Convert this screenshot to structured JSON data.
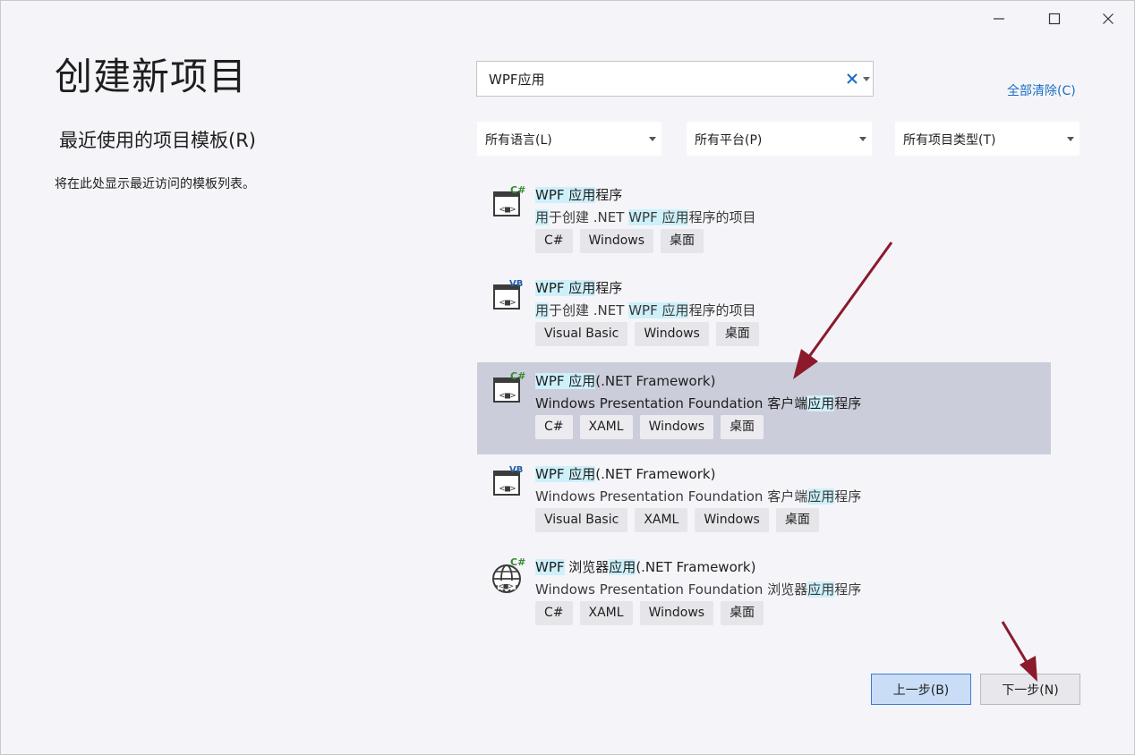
{
  "window_controls": {
    "minimize_icon": "minimize-icon",
    "maximize_icon": "maximize-icon",
    "close_icon": "close-icon"
  },
  "page_title": "创建新项目",
  "recent": {
    "title": "最近使用的项目模板(R)",
    "empty_text": "将在此处显示最近访问的模板列表。"
  },
  "search": {
    "value": "WPF应用"
  },
  "clear_all_label": "全部清除(C)",
  "filters": {
    "language": "所有语言(L)",
    "platform": "所有平台(P)",
    "project_type": "所有项目类型(T)"
  },
  "templates": [
    {
      "icon": "wpf-app-csharp-icon",
      "name_hl": "WPF 应用",
      "name_rest": "程序",
      "desc_pre": "",
      "desc_hl1": "用",
      "desc_mid1": "于创建 .NET ",
      "desc_hl2": "WPF 应用",
      "desc_post": "程序的项目",
      "tags": [
        "C#",
        "Windows",
        "桌面"
      ]
    },
    {
      "icon": "wpf-app-vb-icon",
      "name_hl": "WPF 应用",
      "name_rest": "程序",
      "desc_pre": "",
      "desc_hl1": "用",
      "desc_mid1": "于创建 .NET ",
      "desc_hl2": "WPF 应用",
      "desc_post": "程序的项目",
      "tags": [
        "Visual Basic",
        "Windows",
        "桌面"
      ]
    },
    {
      "icon": "wpf-framework-csharp-icon",
      "name_hl": "WPF 应用",
      "name_rest": "(.NET Framework)",
      "desc_pre": "Windows Presentation Foundation 客户端",
      "desc_hl1": "应用",
      "desc_mid1": "程序",
      "desc_hl2": "",
      "desc_post": "",
      "tags": [
        "C#",
        "XAML",
        "Windows",
        "桌面"
      ]
    },
    {
      "icon": "wpf-framework-vb-icon",
      "name_hl": "WPF 应用",
      "name_rest": "(.NET Framework)",
      "desc_pre": "Windows Presentation Foundation 客户端",
      "desc_hl1": "应用",
      "desc_mid1": "程序",
      "desc_hl2": "",
      "desc_post": "",
      "tags": [
        "Visual Basic",
        "XAML",
        "Windows",
        "桌面"
      ]
    },
    {
      "icon": "wpf-browser-csharp-icon",
      "name_hl": "WPF",
      "name_rest": " 浏览器",
      "name_hl2": "应用",
      "name_rest2": "(.NET Framework)",
      "desc_pre": "Windows Presentation Foundation 浏览器",
      "desc_hl1": "应用",
      "desc_mid1": "程序",
      "desc_hl2": "",
      "desc_post": "",
      "tags": [
        "C#",
        "XAML",
        "Windows",
        "桌面"
      ]
    }
  ],
  "selected_template_index": 2,
  "buttons": {
    "back": "上一步(B)",
    "next": "下一步(N)"
  },
  "colors": {
    "background": "#f5f5f9",
    "selected_row": "#cbcdda",
    "search_highlight": "#cdf0fb",
    "link": "#1a6fc4",
    "annotation_arrow": "#8b1a2b",
    "back_button": "#c9ddf7"
  }
}
